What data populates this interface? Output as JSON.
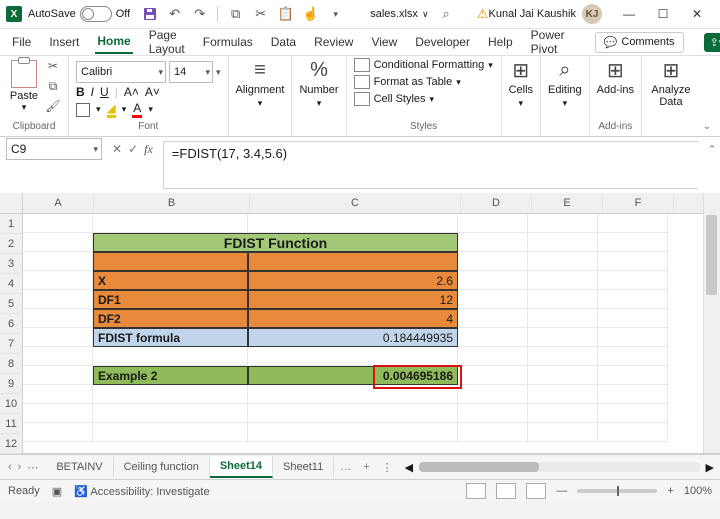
{
  "title": {
    "autosave": "AutoSave",
    "autosave_state": "Off",
    "filename": "sales.xlsx",
    "user": "Kunal Jai Kaushik",
    "user_initials": "KJ"
  },
  "tabs": {
    "file": "File",
    "insert": "Insert",
    "home": "Home",
    "page_layout": "Page Layout",
    "formulas": "Formulas",
    "data": "Data",
    "review": "Review",
    "view": "View",
    "developer": "Developer",
    "help": "Help",
    "power_pivot": "Power Pivot",
    "comments": "Comments"
  },
  "ribbon": {
    "clipboard": {
      "label": "Clipboard",
      "paste": "Paste"
    },
    "font": {
      "label": "Font",
      "family": "Calibri",
      "size": "14",
      "b": "B",
      "i": "I",
      "u": "U",
      "a_inc": "A˄",
      "a_dec": "A˅",
      "a_color": "A",
      "fill": "■"
    },
    "alignment": {
      "label": "Alignment",
      "name": "Alignment",
      "icon": "≡"
    },
    "number": {
      "label": "Number",
      "name": "Number",
      "icon": "%"
    },
    "styles": {
      "label": "Styles",
      "cf": "Conditional Formatting",
      "ft": "Format as Table",
      "cs": "Cell Styles"
    },
    "cells": {
      "label": "Cells",
      "name": "Cells",
      "icon": "⊞"
    },
    "editing": {
      "label": "Editing",
      "name": "Editing"
    },
    "addins": {
      "label": "Add-ins",
      "name": "Add-ins",
      "icon": "⊞"
    },
    "analyze": {
      "label": "",
      "name": "Analyze Data",
      "icon": "⊞"
    }
  },
  "namebox": "C9",
  "formula": "=FDIST(17, 3.4,5.6)",
  "columns": [
    "A",
    "B",
    "C",
    "D",
    "E",
    "F"
  ],
  "rows": [
    "1",
    "2",
    "3",
    "4",
    "5",
    "6",
    "7",
    "8",
    "9",
    "10",
    "11",
    "12"
  ],
  "cells": {
    "title": "FDIST Function",
    "x_lbl": "X",
    "x_val": "2.6",
    "df1_lbl": "DF1",
    "df1_val": "12",
    "df2_lbl": "DF2",
    "df2_val": "4",
    "formula_lbl": "FDIST formula",
    "formula_val": "0.184449935",
    "ex2_lbl": "Example 2",
    "ex2_val": "0.004695186"
  },
  "sheets": {
    "s1": "BETAINV",
    "s2": "Ceiling function",
    "s3": "Sheet14",
    "s4": "Sheet11",
    "more": "…",
    "add": "+"
  },
  "status": {
    "ready": "Ready",
    "acc": "Accessibility: Investigate",
    "zoom": "100%"
  }
}
